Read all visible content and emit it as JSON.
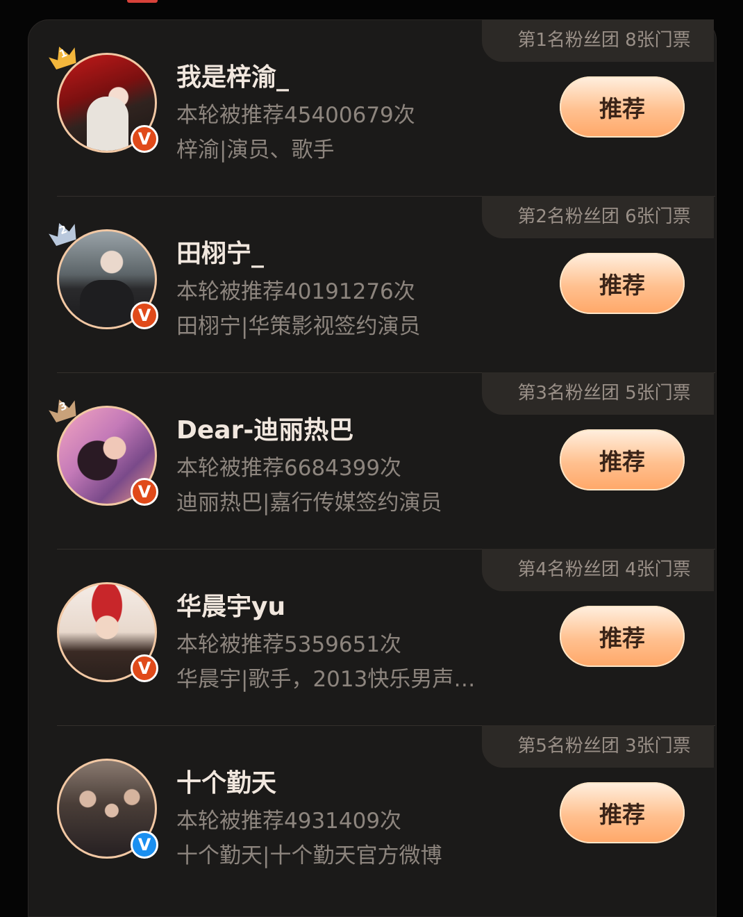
{
  "colors": {
    "accent": "#ffb27a",
    "verified_orange": "#e04a1a",
    "verified_blue": "#1a8ff0"
  },
  "button_label": "推荐",
  "rows": [
    {
      "rank_tag": "第1名粉丝团 8张门票",
      "rank": "1",
      "name": "我是梓渝_",
      "count": "本轮被推荐45400679次",
      "desc": "梓渝|演员、歌手",
      "verify": "orange",
      "verify_label": "V"
    },
    {
      "rank_tag": "第2名粉丝团 6张门票",
      "rank": "2",
      "name": "田栩宁_",
      "count": "本轮被推荐40191276次",
      "desc": "田栩宁|华策影视签约演员",
      "verify": "orange",
      "verify_label": "V"
    },
    {
      "rank_tag": "第3名粉丝团 5张门票",
      "rank": "3",
      "name": "Dear-迪丽热巴",
      "count": "本轮被推荐6684399次",
      "desc": "迪丽热巴|嘉行传媒签约演员",
      "verify": "orange",
      "verify_label": "V"
    },
    {
      "rank_tag": "第4名粉丝团 4张门票",
      "rank": "",
      "name": "华晨宇yu",
      "count": "本轮被推荐5359651次",
      "desc": "华晨宇|歌手，2013快乐男声…",
      "verify": "orange",
      "verify_label": "V"
    },
    {
      "rank_tag": "第5名粉丝团 3张门票",
      "rank": "",
      "name": "十个勤天",
      "count": "本轮被推荐4931409次",
      "desc": "十个勤天|十个勤天官方微博",
      "verify": "blue",
      "verify_label": "V"
    }
  ]
}
